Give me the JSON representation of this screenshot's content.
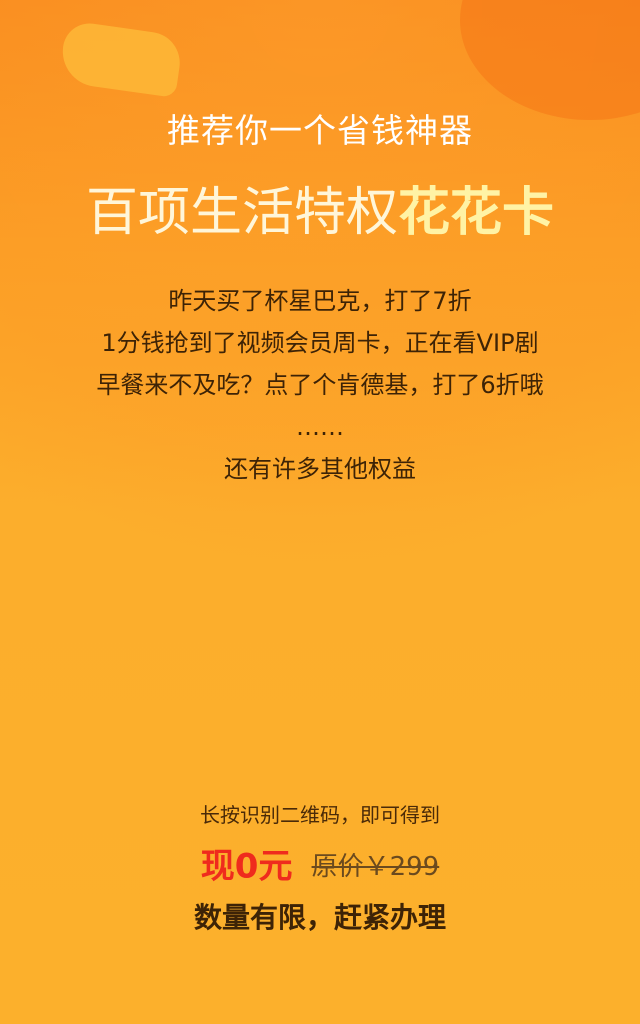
{
  "header": {
    "headline": "推荐你一个省钱神器",
    "title_main": "百项生活特权",
    "title_emphasis": "花花卡"
  },
  "benefits": [
    "昨天买了杯星巴克，打了7折",
    "1分钱抢到了视频会员周卡，正在看VIP剧",
    "早餐来不及吃？点了个肯德基，打了6折哦",
    "……",
    "还有许多其他权益"
  ],
  "footer": {
    "scan_text": "长按识别二维码，即可得到",
    "price_now": "现0元",
    "price_original": "原价￥299",
    "limited_text": "数量有限，赶紧办理"
  },
  "colors": {
    "background_top": "#f78a1d",
    "background_bottom": "#fcb02c",
    "price_now": "#ef2b1d",
    "title_emphasis": "#fff3a5"
  }
}
